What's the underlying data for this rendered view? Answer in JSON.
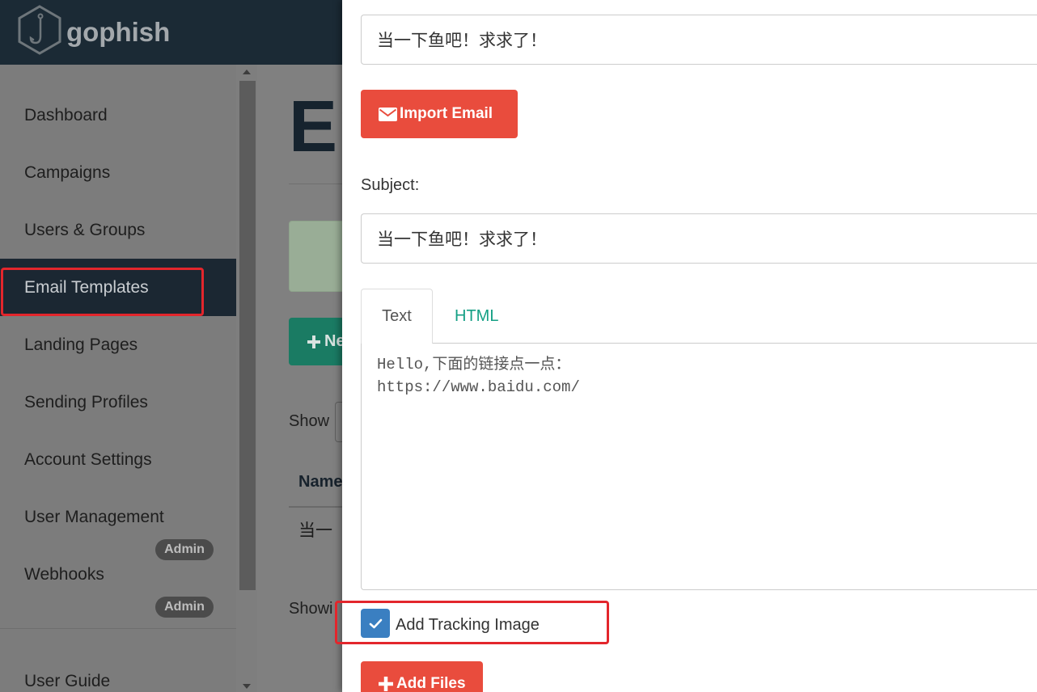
{
  "app": {
    "logo_text": "gophish"
  },
  "sidebar": {
    "items": [
      {
        "label": "Dashboard"
      },
      {
        "label": "Campaigns"
      },
      {
        "label": "Users & Groups"
      },
      {
        "label": "Email Templates",
        "active": true
      },
      {
        "label": "Landing Pages"
      },
      {
        "label": "Sending Profiles"
      },
      {
        "label": "Account Settings"
      },
      {
        "label": "User Management",
        "badge": "Admin"
      },
      {
        "label": "Webhooks",
        "badge": "Admin"
      }
    ],
    "footer_items": [
      {
        "label": "User Guide"
      }
    ]
  },
  "main": {
    "page_title": "Em",
    "new_template_button_label": "Ne",
    "show_entries_label": "Show",
    "table": {
      "columns": [
        "Name"
      ],
      "rows": [
        [
          "当一"
        ]
      ]
    },
    "showing_entries_text": "Showi"
  },
  "modal": {
    "template_name_value": "当一下鱼吧！求求了！",
    "import_email_button_label": "Import Email",
    "subject_label": "Subject:",
    "subject_value": "当一下鱼吧！求求了！",
    "tabs": [
      {
        "label": "Text",
        "active": true
      },
      {
        "label": "HTML"
      }
    ],
    "text_body": "Hello,下面的链接点一点：\nhttps://www.baidu.com/",
    "add_tracking_image_label": "Add Tracking Image",
    "add_tracking_image_checked": true,
    "add_files_button_label": "Add Files"
  },
  "icons": {
    "logo": "gophish-hexagon-hook-icon",
    "new_template": "plus-icon",
    "import_email": "envelope-icon",
    "tracking_checkbox": "check-icon",
    "add_files": "plus-icon",
    "scroll_up": "chevron-up-icon",
    "scroll_down": "chevron-down-icon"
  },
  "colors": {
    "navbar": "#1b2a35",
    "active_nav_item": "#1b2732",
    "danger_button": "#e94c3d",
    "primary_button": "#1a7b63",
    "tab_link": "#15a085",
    "checkbox_checked": "#3a7fc1",
    "annotation_highlight": "#e3262c"
  }
}
